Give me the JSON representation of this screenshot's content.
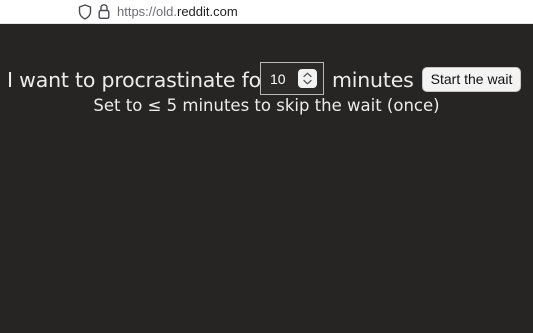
{
  "browser": {
    "url_scheme": "https://",
    "url_subdomain": "old.",
    "url_domain": "reddit.com",
    "icons": [
      "shield-icon",
      "lock-icon"
    ]
  },
  "prompt": {
    "lead_text": "I want to procrastinate for",
    "minutes_value": "10",
    "trail_text": "minutes",
    "start_button_label": "Start the wait",
    "hint_text": "Set to ≤ 5 minutes to skip the wait (once)"
  },
  "colors": {
    "page_background": "#272523",
    "text": "#ececec",
    "button_background": "#f3f3f3"
  }
}
